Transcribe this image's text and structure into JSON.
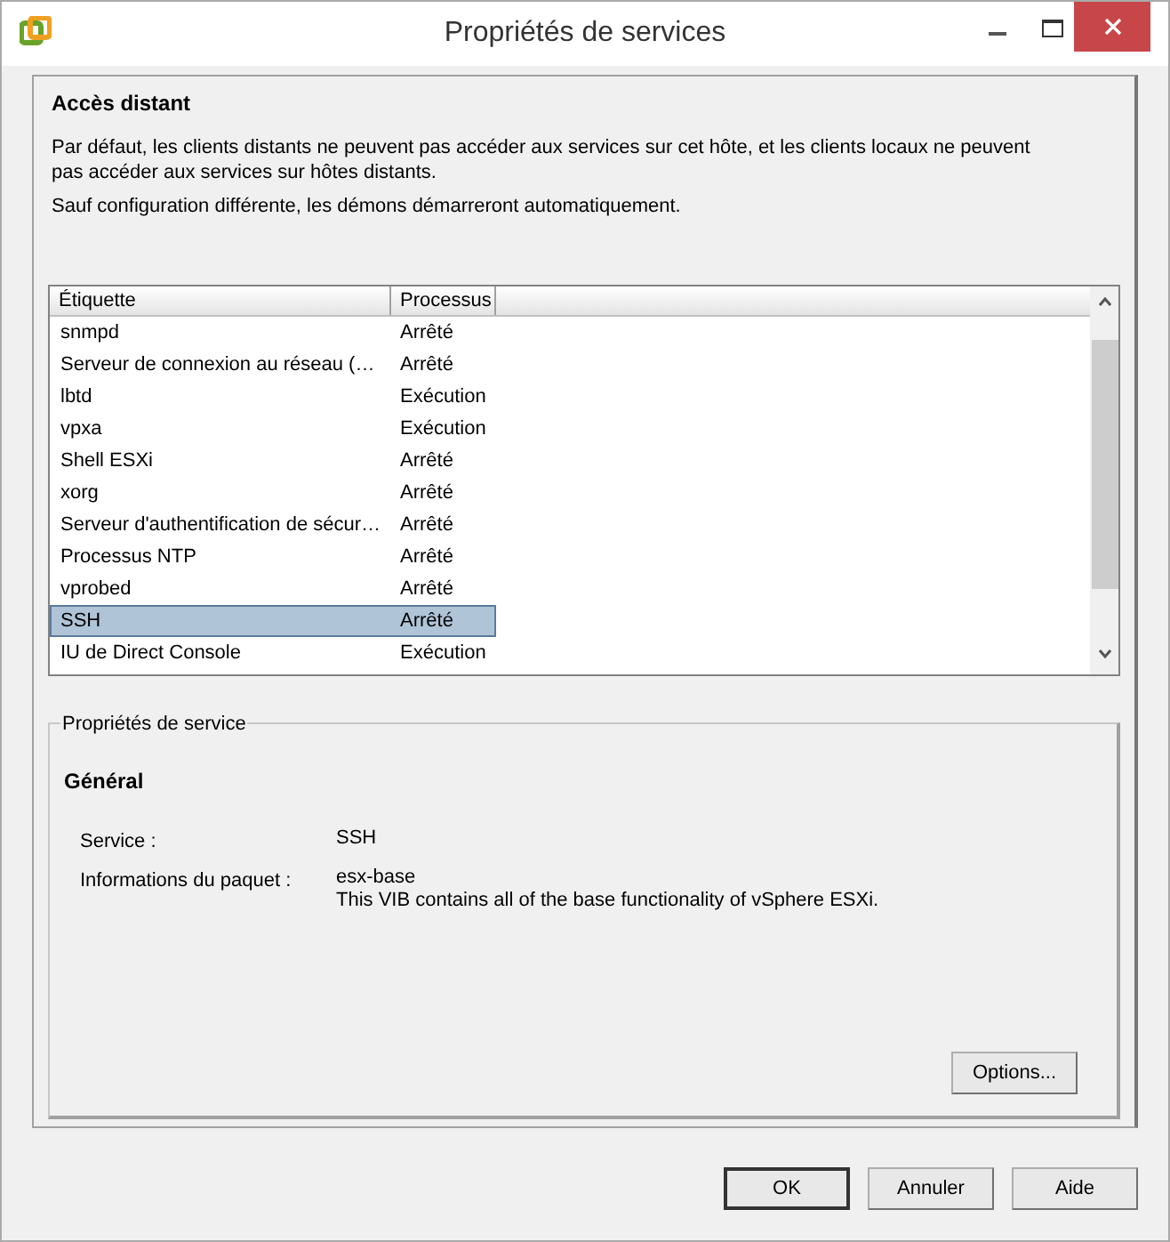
{
  "window": {
    "title": "Propriétés de services"
  },
  "remote_access": {
    "heading": "Accès distant",
    "paragraphs": [
      "Par défaut, les clients distants ne peuvent pas accéder aux services sur cet hôte, et les clients locaux ne peuvent pas accéder aux services sur hôtes distants.",
      "Sauf configuration différente, les démons démarreront automatiquement."
    ]
  },
  "table": {
    "columns": [
      "Étiquette",
      "Processus"
    ],
    "rows": [
      {
        "label": "snmpd",
        "process": "Arrêté",
        "selected": false
      },
      {
        "label": "Serveur de connexion au réseau (…",
        "process": "Arrêté",
        "selected": false
      },
      {
        "label": "lbtd",
        "process": "Exécution",
        "selected": false
      },
      {
        "label": "vpxa",
        "process": "Exécution",
        "selected": false
      },
      {
        "label": "Shell ESXi",
        "process": "Arrêté",
        "selected": false
      },
      {
        "label": "xorg",
        "process": "Arrêté",
        "selected": false
      },
      {
        "label": "Serveur d'authentification de sécur…",
        "process": "Arrêté",
        "selected": false
      },
      {
        "label": "Processus NTP",
        "process": "Arrêté",
        "selected": false
      },
      {
        "label": "vprobed",
        "process": "Arrêté",
        "selected": false
      },
      {
        "label": "SSH",
        "process": "Arrêté",
        "selected": true
      },
      {
        "label": "IU de Direct Console",
        "process": "Exécution",
        "selected": false
      }
    ]
  },
  "service_properties": {
    "legend": "Propriétés de service",
    "heading": "Général",
    "fields": [
      {
        "label": "Service :",
        "values": [
          "SSH"
        ]
      },
      {
        "label": "Informations du paquet :",
        "values": [
          "esx-base",
          "This VIB contains all of the base functionality of vSphere ESXi."
        ]
      }
    ],
    "options_button": "Options..."
  },
  "buttons": [
    {
      "label": "OK",
      "default": true
    },
    {
      "label": "Annuler",
      "default": false
    },
    {
      "label": "Aide",
      "default": false
    }
  ]
}
